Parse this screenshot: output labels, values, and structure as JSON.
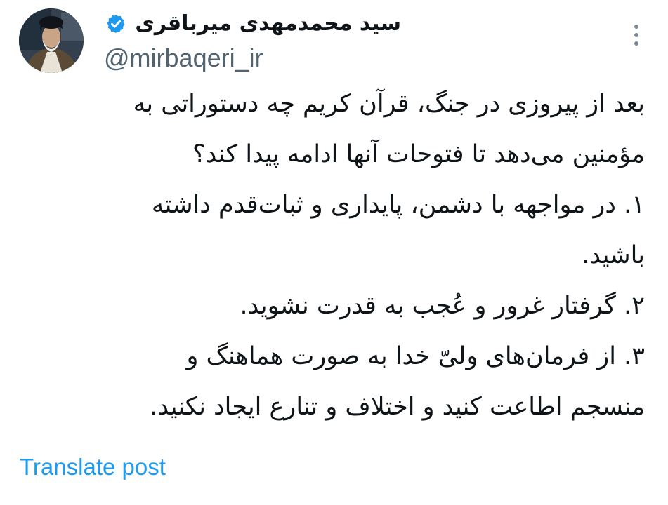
{
  "author": {
    "display_name": "سید محمدمهدی میرباقری",
    "handle": "@mirbaqeri_ir",
    "verified_icon": "verified-badge-icon",
    "avatar_icon": "profile-photo"
  },
  "menu": {
    "icon": "more-vertical-icon"
  },
  "tweet": {
    "lines": [
      "بعد از پیروزی در جنگ، قرآن کریم چه دستوراتی به",
      "مؤمنین می‌دهد تا فتوحات آنها ادامه پیدا کند؟",
      "۱. در مواجهه با دشمن، پایداری و ثبات‌قدم داشته",
      "باشید.",
      "۲. گرفتار غرور و عُجب به قدرت نشوید.",
      "۳. از فرمان‌های ولیّ خدا به صورت هماهنگ و",
      "منسجم اطاعت کنید و اختلاف و تنارع ایجاد نکنید."
    ]
  },
  "translate": {
    "label": "Translate post"
  },
  "colors": {
    "link": "#1d9bf0",
    "verified": "#1d9bf0",
    "text": "#0f1419",
    "secondary": "#536471"
  }
}
